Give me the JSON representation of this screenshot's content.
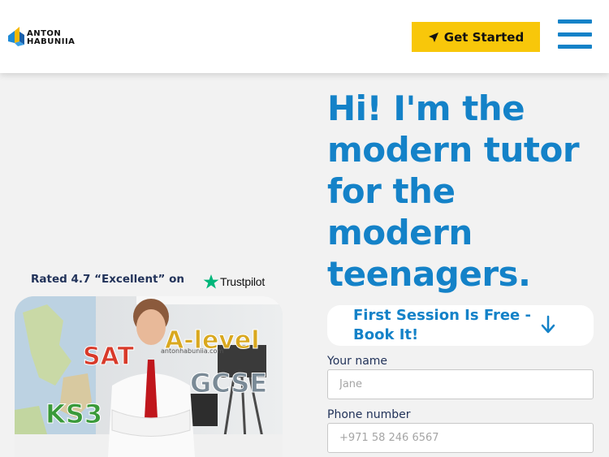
{
  "header": {
    "logo_line1": "ANTON",
    "logo_line2": "HABUNIIA",
    "cta_label": "Get Started",
    "cta_icon": "location-arrow-icon",
    "menu_icon": "hamburger-menu-icon"
  },
  "hero": {
    "title": "Hi! I'm the modern tutor for the modern teenagers."
  },
  "rating": {
    "text": "Rated 4.7 “Excellent” on",
    "platform": "Trustpilot"
  },
  "photo": {
    "labels": [
      "SAT",
      "A-level",
      "GCSE",
      "KS3"
    ],
    "watermark": "antonhabuniia.com"
  },
  "free_session": {
    "label": "First Session Is Free - Book It!",
    "icon": "arrow-down-icon"
  },
  "form": {
    "name_label": "Your name",
    "name_placeholder": "Jane",
    "phone_label": "Phone number",
    "phone_placeholder": "+971 58 246 6567"
  },
  "colors": {
    "brand_blue": "#1482c8",
    "cta_yellow": "#f8c70a",
    "trustpilot_green": "#00b67a",
    "navy_text": "#22335a",
    "background": "#f2f2f2"
  }
}
